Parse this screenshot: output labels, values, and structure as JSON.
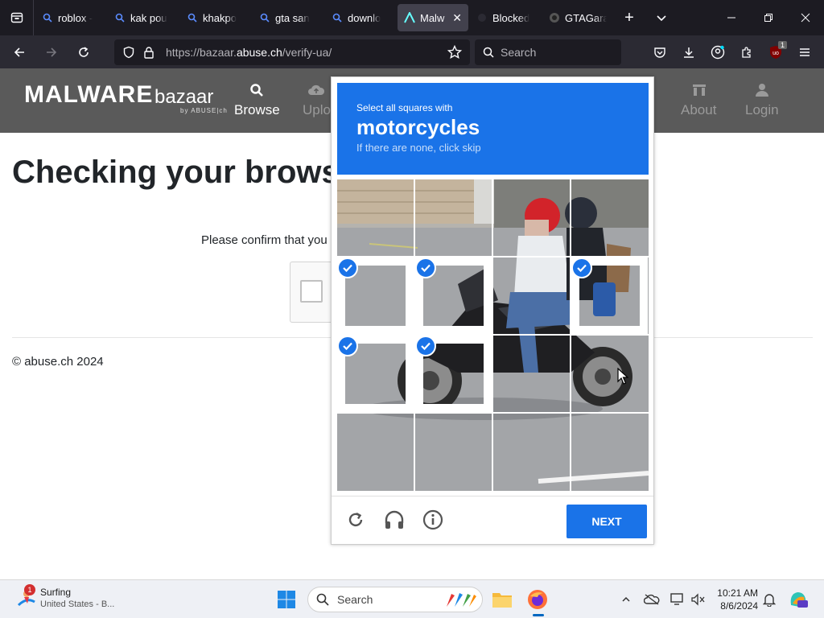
{
  "browser": {
    "tabs": [
      {
        "label": "roblox -",
        "icon": "search-icon"
      },
      {
        "label": "kak pou",
        "icon": "search-icon"
      },
      {
        "label": "khakpo",
        "icon": "search-icon"
      },
      {
        "label": "gta san",
        "icon": "search-icon"
      },
      {
        "label": "downlo",
        "icon": "search-icon"
      },
      {
        "label": "Malw",
        "icon": "malwarebazaar-icon",
        "active": true
      },
      {
        "label": "Blocked",
        "icon": "blocked-icon"
      },
      {
        "label": "GTAGara",
        "icon": "gtagarage-icon"
      }
    ],
    "url_prefix": "https://bazaar.",
    "url_domain": "abuse.ch",
    "url_path": "/verify-ua/",
    "search_placeholder": "Search",
    "ublock_badge": "1"
  },
  "site": {
    "logo_main": "MALWARE",
    "logo_sub": "bazaar",
    "logo_by": "by ABUSE|ch",
    "nav": {
      "browse": "Browse",
      "upload": "Uplo",
      "about": "About",
      "login": "Login"
    },
    "page_title": "Checking your browser",
    "confirm_text": "Please confirm that you",
    "copyright": "© abuse.ch 2024"
  },
  "captcha": {
    "instruction": "Select all squares with",
    "target": "motorcycles",
    "hint": "If there are none, click skip",
    "selected_tiles": [
      4,
      5,
      7,
      8,
      9
    ],
    "next_label": "NEXT"
  },
  "taskbar": {
    "weather_title": "Surfing",
    "weather_sub": "United States - B...",
    "weather_badge": "1",
    "search_placeholder": "Search",
    "time": "10:21 AM",
    "date": "8/6/2024"
  }
}
